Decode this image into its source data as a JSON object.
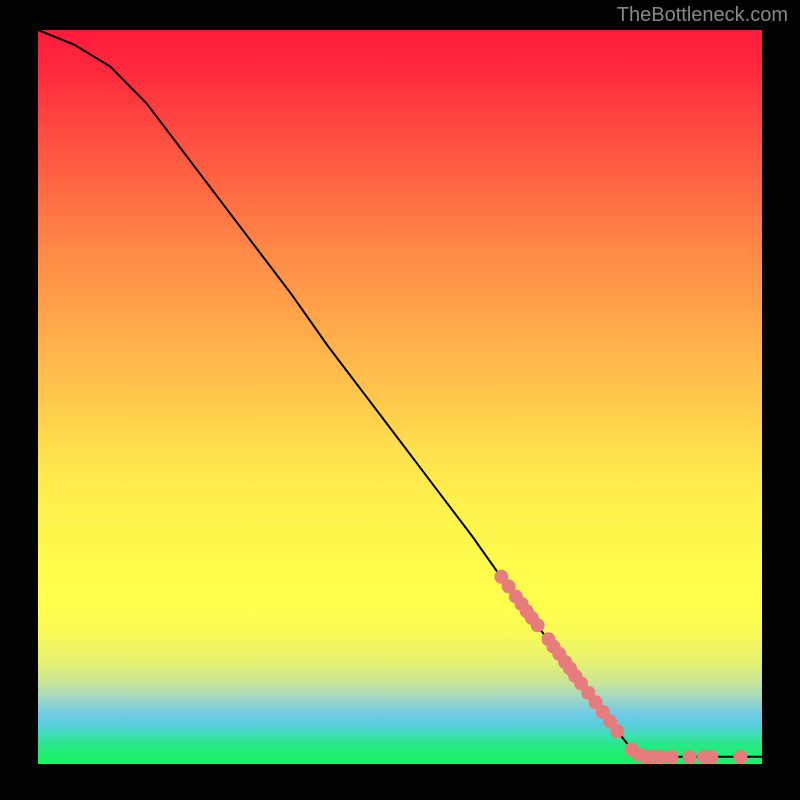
{
  "attribution": "TheBottleneck.com",
  "chart_data": {
    "type": "line",
    "title": "",
    "xlabel": "",
    "ylabel": "",
    "xlim": [
      0,
      100
    ],
    "ylim": [
      0,
      100
    ],
    "curve": [
      {
        "x": 0,
        "y": 100
      },
      {
        "x": 5,
        "y": 98
      },
      {
        "x": 10,
        "y": 95
      },
      {
        "x": 15,
        "y": 90
      },
      {
        "x": 20,
        "y": 83.5
      },
      {
        "x": 25,
        "y": 77
      },
      {
        "x": 30,
        "y": 70.5
      },
      {
        "x": 35,
        "y": 64
      },
      {
        "x": 40,
        "y": 57
      },
      {
        "x": 45,
        "y": 50.5
      },
      {
        "x": 50,
        "y": 44
      },
      {
        "x": 55,
        "y": 37.5
      },
      {
        "x": 60,
        "y": 31
      },
      {
        "x": 65,
        "y": 24
      },
      {
        "x": 70,
        "y": 17.5
      },
      {
        "x": 75,
        "y": 11
      },
      {
        "x": 80,
        "y": 4.5
      },
      {
        "x": 82,
        "y": 2
      },
      {
        "x": 84,
        "y": 1
      },
      {
        "x": 90,
        "y": 1
      },
      {
        "x": 95,
        "y": 1
      },
      {
        "x": 100,
        "y": 1
      }
    ],
    "highlighted_points": [
      {
        "x": 64,
        "y": 25.5
      },
      {
        "x": 65,
        "y": 24.2
      },
      {
        "x": 66,
        "y": 22.8
      },
      {
        "x": 66.8,
        "y": 21.8
      },
      {
        "x": 67.5,
        "y": 20.8
      },
      {
        "x": 68.2,
        "y": 19.9
      },
      {
        "x": 69.0,
        "y": 18.9
      },
      {
        "x": 70.5,
        "y": 17.0
      },
      {
        "x": 71.2,
        "y": 16.0
      },
      {
        "x": 72.0,
        "y": 15.0
      },
      {
        "x": 72.8,
        "y": 13.9
      },
      {
        "x": 73.5,
        "y": 13.0
      },
      {
        "x": 74.2,
        "y": 12.0
      },
      {
        "x": 75.0,
        "y": 11.0
      },
      {
        "x": 76.0,
        "y": 9.7
      },
      {
        "x": 77.0,
        "y": 8.4
      },
      {
        "x": 78.0,
        "y": 7.1
      },
      {
        "x": 79.0,
        "y": 5.8
      },
      {
        "x": 80.0,
        "y": 4.5
      },
      {
        "x": 82.0,
        "y": 2.0
      },
      {
        "x": 83.0,
        "y": 1.3
      },
      {
        "x": 84.0,
        "y": 1.0
      },
      {
        "x": 85.0,
        "y": 1.0
      },
      {
        "x": 86.0,
        "y": 1.0
      },
      {
        "x": 87.5,
        "y": 1.0
      },
      {
        "x": 90.0,
        "y": 1.0
      },
      {
        "x": 92.0,
        "y": 1.0
      },
      {
        "x": 93.0,
        "y": 1.0
      },
      {
        "x": 97.0,
        "y": 1.0
      }
    ],
    "point_color": "#e67c7c",
    "point_radius": 7
  }
}
